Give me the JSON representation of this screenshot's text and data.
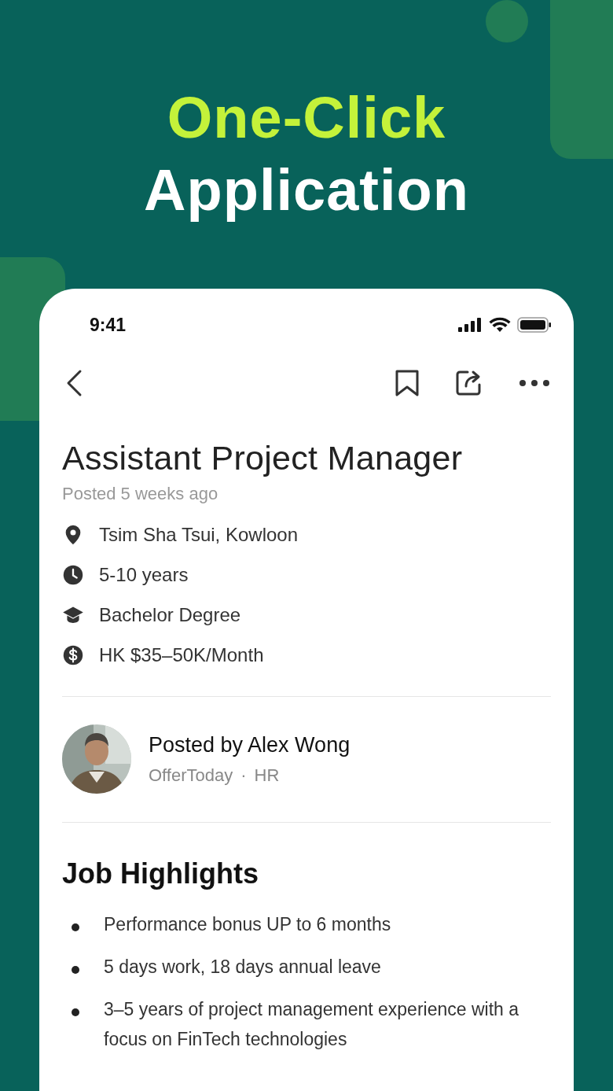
{
  "promo": {
    "headline_accent": "One-Click",
    "headline": "Application"
  },
  "status_bar": {
    "time": "9:41"
  },
  "job": {
    "title": "Assistant Project Manager",
    "posted": "Posted 5 weeks ago",
    "details": [
      {
        "kind": "location",
        "text": "Tsim Sha Tsui, Kowloon"
      },
      {
        "kind": "experience",
        "text": "5-10 years"
      },
      {
        "kind": "education",
        "text": "Bachelor Degree"
      },
      {
        "kind": "salary",
        "text": "HK $35–50K/Month"
      }
    ]
  },
  "poster": {
    "name": "Posted by Alex Wong",
    "company": "OfferToday",
    "separator": "·",
    "role": "HR"
  },
  "highlights": {
    "title": "Job Highlights",
    "items": [
      "Performance bonus UP to 6 months",
      "5 days work, 18 days annual leave",
      "3–5 years of project management experience with a focus on FinTech technologies"
    ]
  }
}
